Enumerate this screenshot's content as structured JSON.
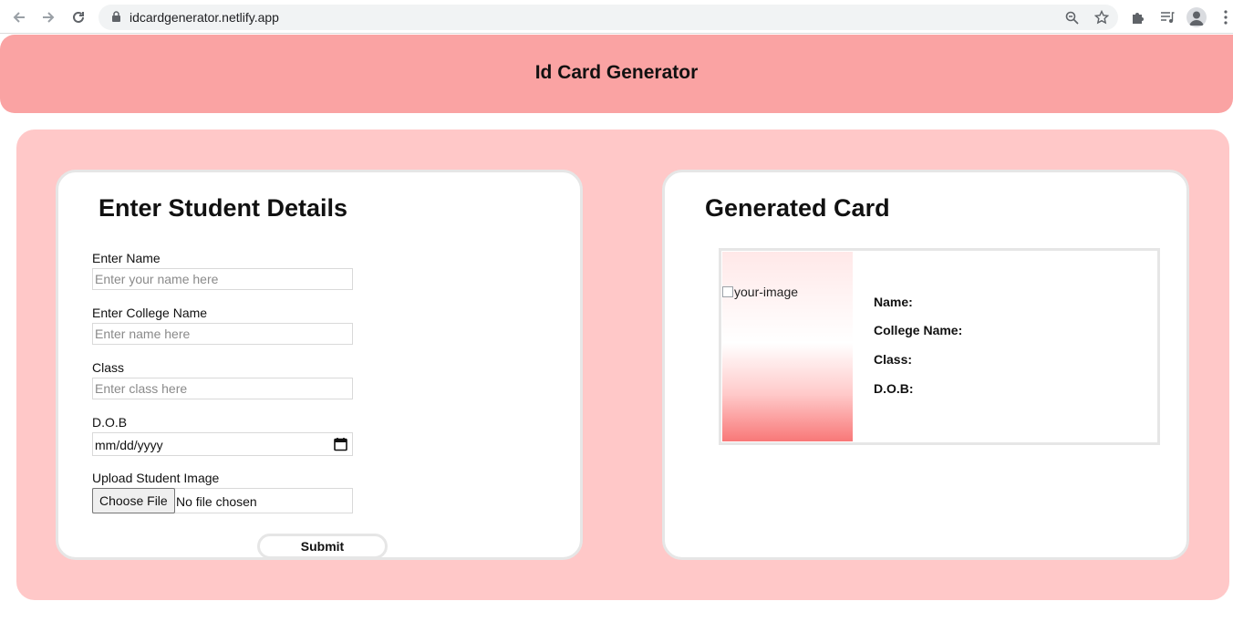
{
  "browser": {
    "url": "idcardgenerator.netlify.app"
  },
  "header": {
    "title": "Id Card Generator"
  },
  "form": {
    "title": "Enter Student Details",
    "name_label": "Enter Name",
    "name_placeholder": "Enter your name here",
    "college_label": "Enter College Name",
    "college_placeholder": "Enter name here",
    "class_label": "Class",
    "class_placeholder": "Enter class here",
    "dob_label": "D.O.B",
    "dob_placeholder": "mm/dd/yyyy",
    "image_label": "Upload Student Image",
    "file_button": "Choose File",
    "file_status": "No file chosen",
    "submit_label": "Submit"
  },
  "card": {
    "title": "Generated Card",
    "image_alt": "your-image",
    "name_label": "Name:",
    "college_label": "College Name:",
    "class_label": "Class:",
    "dob_label": "D.O.B:"
  },
  "colors": {
    "header_bg": "#faa3a3",
    "panel_bg": "#ffc8c8"
  },
  "icons": {
    "back": "arrow-left-icon",
    "forward": "arrow-right-icon",
    "reload": "reload-icon",
    "lock": "lock-icon",
    "zoom": "zoom-out-icon",
    "bookmark": "star-icon",
    "extensions": "puzzle-icon",
    "media": "playlist-icon",
    "profile": "account-icon",
    "menu": "kebab-menu-icon",
    "calendar": "calendar-icon"
  }
}
